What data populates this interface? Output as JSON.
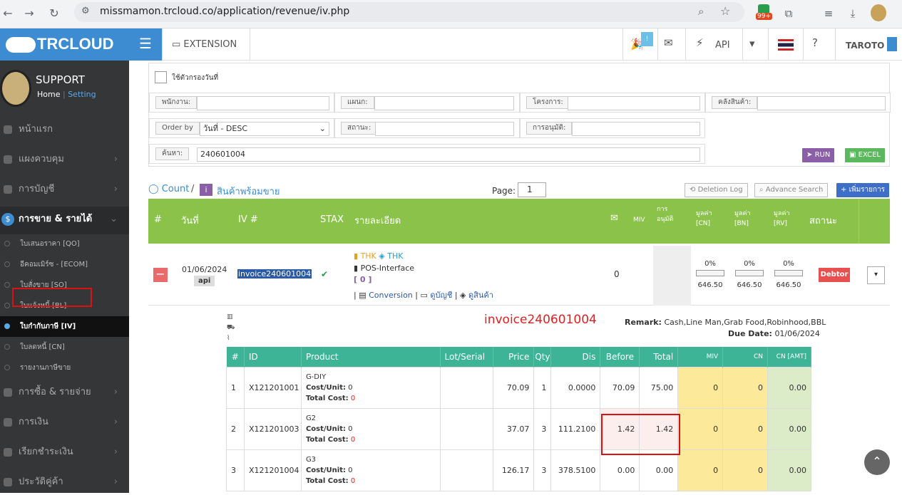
{
  "browser": {
    "url": "missmamon.trcloud.co/application/revenue/iv.php",
    "notif_count": "99+"
  },
  "app": {
    "logo": "TRCLOUD",
    "user_name": "SUPPORT",
    "home_link": "Home",
    "setting_link": "Setting"
  },
  "sidebar": {
    "menus": [
      {
        "label": "หน้าแรก"
      },
      {
        "label": "แผงควบคุม"
      },
      {
        "label": "การบัญชี"
      },
      {
        "label": "การขาย & รายได้"
      },
      {
        "label": "การซื้อ & รายจ่าย"
      },
      {
        "label": "การเงิน"
      },
      {
        "label": "เรียกชำระเงิน"
      },
      {
        "label": "ประวัติคู่ค้า"
      }
    ],
    "sub_items": [
      {
        "label": "ใบเสนอราคา [QO]"
      },
      {
        "label": "อีคอมเมิร์ซ - [ECOM]"
      },
      {
        "label": "ใบสั่งขาย [SO]"
      },
      {
        "label": "ใบแจ้งหนี้ [BL]"
      },
      {
        "label": "ใบกำกับภาษี [IV]"
      },
      {
        "label": "ใบลดหนี้ [CN]"
      },
      {
        "label": "รายงานภาษีขาย"
      }
    ]
  },
  "header": {
    "extension": "EXTENSION",
    "api": "API",
    "badge": "!",
    "user": "TAROTO"
  },
  "filter": {
    "date_filter_label": "ใช้ตัวกรองวันที่",
    "employee_label": "พนักงาน:",
    "department_label": "แผนก:",
    "project_label": "โครงการ:",
    "warehouse_label": "คลังสินค้า:",
    "order_by_label": "Order by",
    "order_by_value": "วันที่ - DESC",
    "status_label": "สถานะ:",
    "approval_label": "การอนุมัติ:",
    "search_label": "ค้นหา:",
    "search_value": "240601004",
    "run": "RUN",
    "excel": "EXCEL"
  },
  "toolbar": {
    "count": "Count",
    "slash": "/",
    "ready_goods": "สินค้าพร้อมขาย",
    "page_label": "Page:",
    "page_value": "1",
    "deletion_log": "Deletion Log",
    "advance_search": "Advance Search",
    "add_item": "เพิ่มรายการ"
  },
  "list_header": {
    "hash": "#",
    "date": "วันที่",
    "iv": "IV #",
    "stax": "STAX",
    "detail": "รายละเอียด",
    "miv": "MIV",
    "approval": "การ อนุมัติ",
    "val_cn": "มูลค่า [CN]",
    "val_bn": "มูลค่า [BN]",
    "val_rv": "มูลค่า [RV]",
    "status": "สถานะ"
  },
  "invoice_row": {
    "date": "01/06/2024",
    "source": "api",
    "iv_no": "invoice240601004",
    "company1": "THK",
    "company2": "THK",
    "interface": "POS-Interface",
    "bracket": "[ 0 ]",
    "conversion": "Conversion",
    "view_account": "ดูบัญชี",
    "view_goods": "ดูสินค้า",
    "mail_count": "0",
    "pct_cn": "0%",
    "pct_bn": "0%",
    "pct_rv": "0%",
    "amt_cn": "646.50",
    "amt_bn": "646.50",
    "amt_rv": "646.50",
    "status": "Debtor"
  },
  "detail": {
    "title": "invoice240601004",
    "remark_label": "Remark:",
    "remark": "Cash,Line Man,Grab Food,Robinhood,BBL",
    "due_label": "Due Date:",
    "due": "01/06/2024",
    "columns": [
      "#",
      "ID",
      "Product",
      "Lot/Serial",
      "Price",
      "Qty",
      "Dis",
      "Before",
      "Total",
      "MIV",
      "CN",
      "CN [AMT]"
    ],
    "cost_label": "Cost/Unit:",
    "total_cost_label": "Total Cost:",
    "rows": [
      {
        "no": "1",
        "id": "X121201001",
        "product": "G-DIY",
        "cost": "0",
        "total_cost": "0",
        "price": "70.09",
        "qty": "1",
        "dis": "0.0000",
        "before": "70.09",
        "total": "75.00",
        "miv": "0",
        "cn": "0",
        "cn_amt": "0.00"
      },
      {
        "no": "2",
        "id": "X121201003",
        "product": "G2",
        "cost": "0",
        "total_cost": "0",
        "price": "37.07",
        "qty": "3",
        "dis": "111.2100",
        "before": "1.42",
        "total": "1.42",
        "miv": "0",
        "cn": "0",
        "cn_amt": "0.00"
      },
      {
        "no": "3",
        "id": "X121201004",
        "product": "G3",
        "cost": "0",
        "total_cost": "0",
        "price": "126.17",
        "qty": "3",
        "dis": "378.5100",
        "before": "0.00",
        "total": "0.00",
        "miv": "0",
        "cn": "0",
        "cn_amt": "0.00"
      }
    ]
  },
  "colors": {
    "brand": "#3d8bd1",
    "list_header": "#8bc34a",
    "table_header": "#3cb495",
    "debtor": "#e85050",
    "highlight": "#d11111"
  }
}
